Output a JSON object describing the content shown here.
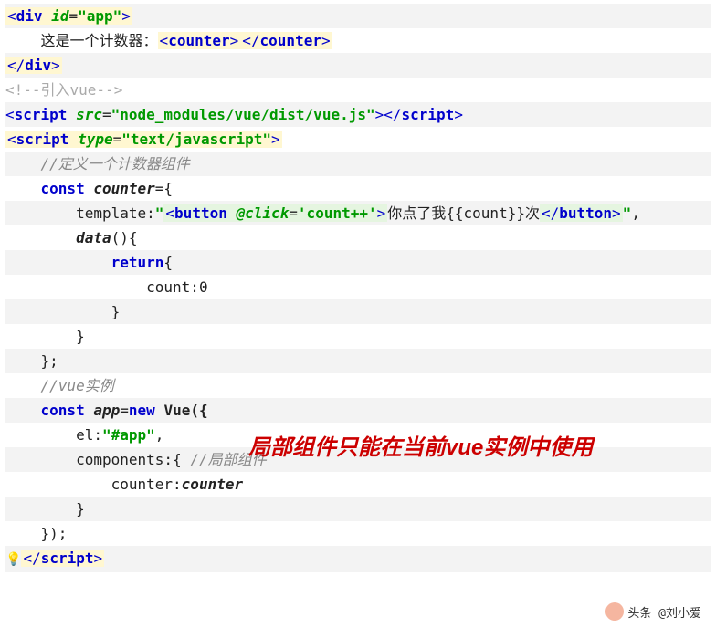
{
  "lines": {
    "l1_open": "<",
    "l1_tag": "div",
    "l1_sp": " ",
    "l1_attr": "id",
    "l1_eq": "=",
    "l1_val": "\"app\"",
    "l1_close": ">",
    "l2_indent": "    ",
    "l2_text": "这是一个计数器：",
    "l2_cnt_open": "<",
    "l2_cnt_tag": "counter",
    "l2_cnt_close": ">",
    "l2_cnt_open2": "</",
    "l2_cnt_close2": ">",
    "l3_open": "</",
    "l3_tag": "div",
    "l3_close": ">",
    "l4_comment": "<!--引入vue-->",
    "l5_open": "<",
    "l5_tag": "script",
    "l5_sp": " ",
    "l5_attr": "src",
    "l5_eq": "=",
    "l5_val": "\"node_modules/vue/dist/vue.js\"",
    "l5_close": ">",
    "l5_open2": "</",
    "l5_close2": ">",
    "l6_open": "<",
    "l6_tag": "script",
    "l6_sp": " ",
    "l6_attr": "type",
    "l6_eq": "=",
    "l6_val": "\"text/javascript\"",
    "l6_close": ">",
    "l7_indent": "    ",
    "l7_comment": "//定义一个计数器组件",
    "l8_indent": "    ",
    "l8_const": "const",
    "l8_sp": " ",
    "l8_ident": "counter",
    "l8_eq": "={",
    "l9_indent": "        ",
    "l9_prop": "template",
    "l9_col": ":",
    "l9_q": "\"",
    "l9_bo": "<",
    "l9_btn": "button",
    "l9_bs": " ",
    "l9_click": "@click",
    "l9_eq2": "=",
    "l9_cv": "'count++'",
    "l9_bc": ">",
    "l9_txt": "你点了我{{count}}次",
    "l9_bo2": "</",
    "l9_bc2": ">",
    "l9_q2": "\"",
    "l9_cm": ",",
    "l10_indent": "        ",
    "l10_data": "data",
    "l10_paren": "(){",
    "l11_indent": "            ",
    "l11_return": "return",
    "l11_brace": "{",
    "l12_indent": "                ",
    "l12_prop": "count",
    "l12_col": ":",
    "l12_zero": "0",
    "l13_indent": "            ",
    "l13_brace": "}",
    "l14_indent": "        ",
    "l14_brace": "}",
    "l15_indent": "    ",
    "l15_close": "};",
    "l16_indent": "    ",
    "l16_comment": "//vue实例",
    "l17_indent": "    ",
    "l17_const": "const",
    "l17_sp": " ",
    "l17_ident": "app",
    "l17_eq": "=",
    "l17_new": "new",
    "l17_sp2": " ",
    "l17_vue": "Vue({",
    "l18_indent": "        ",
    "l18_prop": "el",
    "l18_col": ":",
    "l18_val": "\"#app\"",
    "l18_cm": ",",
    "l19_indent": "        ",
    "l19_prop": "components",
    "l19_col": ":{ ",
    "l19_comment": "//局部组件",
    "l20_indent": "            ",
    "l20_key": "counter",
    "l20_col": ":",
    "l20_val": "counter",
    "l21_indent": "        ",
    "l21_brace": "}",
    "l22_indent": "    ",
    "l22_close": "});",
    "l23_open": "</",
    "l23_tag": "script",
    "l23_close": ">"
  },
  "annotation": "局部组件只能在当前vue实例中使用",
  "watermark": "头条 @刘小爱"
}
